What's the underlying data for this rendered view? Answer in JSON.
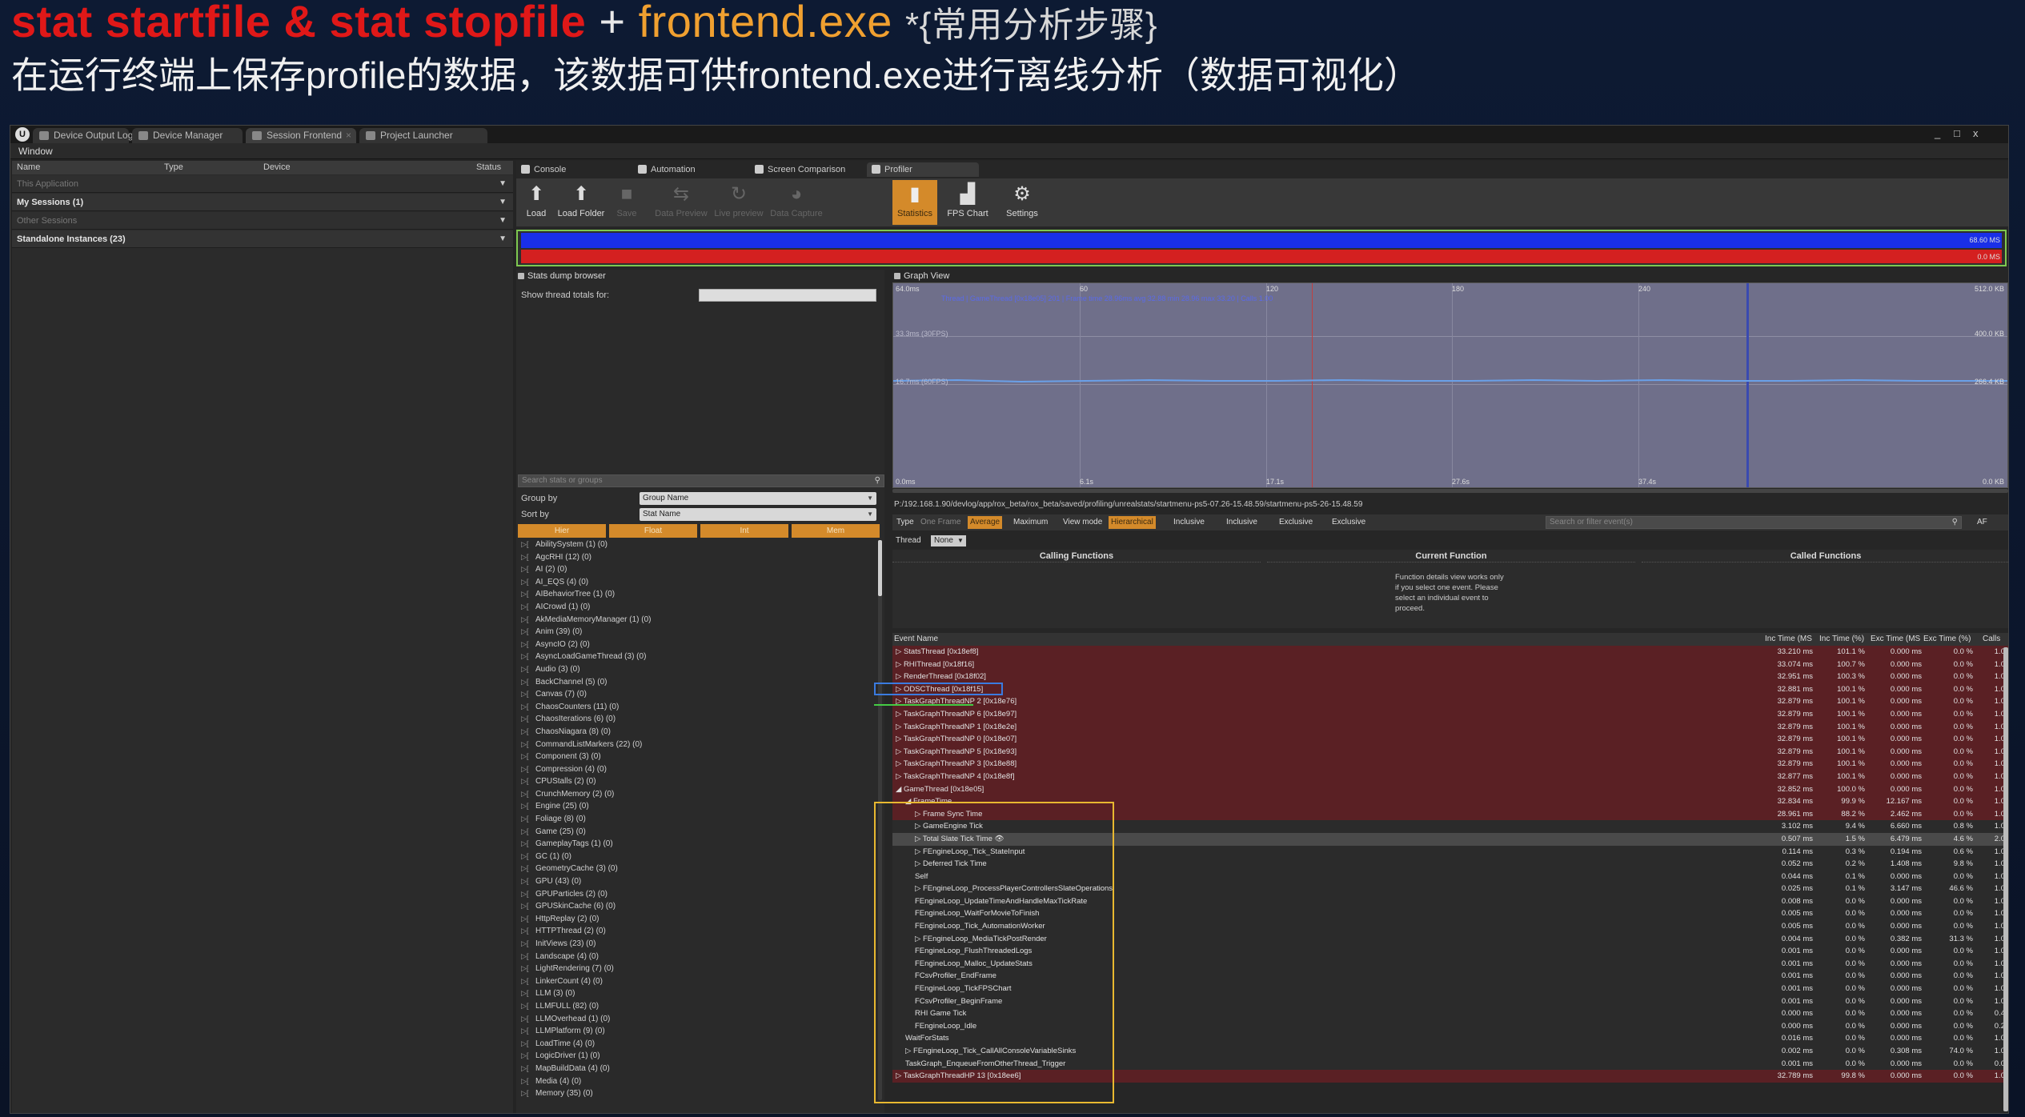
{
  "slide": {
    "title_red": "stat startfile & stat stopfile",
    "title_plus": "+",
    "title_exe": "frontend.exe",
    "title_note": "*{常用分析步骤}",
    "subtitle": "在运行终端上保存profile的数据，该数据可供frontend.exe进行离线分析（数据可视化）"
  },
  "window": {
    "tabs": [
      "Device Output Log",
      "Device Manager",
      "Session Frontend",
      "Project Launcher"
    ],
    "menu": "Window",
    "controls": [
      "_",
      "□",
      "x"
    ]
  },
  "sessions": {
    "columns": [
      "Name",
      "Type",
      "Device",
      "Status"
    ],
    "rows": [
      {
        "label": "This Application",
        "style": "dim"
      },
      {
        "label": "My Sessions (1)",
        "style": "bold"
      },
      {
        "label": "Other Sessions",
        "style": "dim"
      },
      {
        "label": "Standalone Instances (23)",
        "style": "bold"
      }
    ]
  },
  "profiler": {
    "tabs": [
      "Console",
      "Automation",
      "Screen Comparison",
      "Profiler"
    ],
    "toolbar": [
      {
        "label": "Load",
        "state": "normal",
        "icon": "load-icon"
      },
      {
        "label": "Load Folder",
        "state": "normal",
        "icon": "load-folder-icon"
      },
      {
        "label": "Save",
        "state": "disabled",
        "icon": "save-icon"
      },
      {
        "label": "Data Preview",
        "state": "disabled",
        "icon": "data-preview-icon"
      },
      {
        "label": "Live preview",
        "state": "disabled",
        "icon": "live-preview-icon"
      },
      {
        "label": "Data Capture",
        "state": "disabled",
        "icon": "data-capture-icon"
      },
      {
        "label": "Statistics",
        "state": "active",
        "icon": "statistics-icon"
      },
      {
        "label": "FPS Chart",
        "state": "normal",
        "icon": "fps-chart-icon"
      },
      {
        "label": "Settings",
        "state": "normal",
        "icon": "settings-icon"
      }
    ],
    "overview": {
      "top_value": "68.60 MS",
      "bottom_value": "0.0 MS"
    }
  },
  "stats_browser": {
    "title": "Stats dump browser",
    "show_thread_label": "Show thread totals for:",
    "search_placeholder": "Search stats or groups",
    "group_by_label": "Group by",
    "group_by_value": "Group Name",
    "sort_by_label": "Sort by",
    "sort_by_value": "Stat Name",
    "filters": [
      "Hier",
      "Float",
      "Int",
      "Mem"
    ],
    "groups": [
      "AbilitySystem (1) (0)",
      "AgcRHI (12) (0)",
      "AI (2) (0)",
      "AI_EQS (4) (0)",
      "AIBehaviorTree (1) (0)",
      "AICrowd (1) (0)",
      "AkMediaMemoryManager (1) (0)",
      "Anim (39) (0)",
      "AsyncIO (2) (0)",
      "AsyncLoadGameThread (3) (0)",
      "Audio (3) (0)",
      "BackChannel (5) (0)",
      "Canvas (7) (0)",
      "ChaosCounters (11) (0)",
      "ChaosIterations (6) (0)",
      "ChaosNiagara (8) (0)",
      "CommandListMarkers (22) (0)",
      "Component (3) (0)",
      "Compression (4) (0)",
      "CPUStalls (2) (0)",
      "CrunchMemory (2) (0)",
      "Engine (25) (0)",
      "Foliage (8) (0)",
      "Game (25) (0)",
      "GameplayTags (1) (0)",
      "GC (1) (0)",
      "GeometryCache (3) (0)",
      "GPU (43) (0)",
      "GPUParticles (2) (0)",
      "GPUSkinCache (6) (0)",
      "HttpReplay (2) (0)",
      "HTTPThread (2) (0)",
      "InitViews (23) (0)",
      "Landscape (4) (0)",
      "LightRendering (7) (0)",
      "LinkerCount (4) (0)",
      "LLM (3) (0)",
      "LLMFULL (82) (0)",
      "LLMOverhead (1) (0)",
      "LLMPlatform (9) (0)",
      "LoadTime (4) (0)",
      "LogicDriver (1) (0)",
      "MapBuildData (4) (0)",
      "Media (4) (0)",
      "Memory (35) (0)"
    ]
  },
  "graph_view": {
    "title": "Graph View",
    "x_ticks_top": [
      "64.0ms",
      "60",
      "120",
      "180",
      "240"
    ],
    "x_ticks_bottom": [
      "0.0ms",
      "6.1s",
      "17.1s",
      "27.6s",
      "37.4s"
    ],
    "y_right": [
      "512.0 KB",
      "400.0 KB",
      "266.4 KB",
      "0.0 KB"
    ],
    "mid_labels": [
      "33.3ms (30FPS)",
      "16.7ms (60FPS)"
    ],
    "legend_text": "Thread | GameThread [0x18e05] 201 | Frame time 28.96ms avg 32.88 min 28.96 max 33.20 | Calls 1.00"
  },
  "events": {
    "path": "P:/192.168.1.90/devlog/app/rox_beta/rox_beta/saved/profiling/unrealstats/startmenu-ps5-07.26-15.48.59/startmenu-ps5-26-15.48.59",
    "toolbar": {
      "type_label": "Type",
      "type_buttons": [
        "One Frame",
        "Average",
        "Maximum"
      ],
      "view_mode_label": "View mode",
      "view_buttons": [
        "Hierarchical",
        "Inclusive",
        "Inclusive",
        "Exclusive",
        "Exclusive"
      ],
      "search_placeholder": "Search or filter event(s)",
      "af": "AF"
    },
    "thread_label": "Thread",
    "thread_value": "None",
    "function_details": {
      "calling": "Calling Functions",
      "current": "Current Function",
      "called": "Called Functions",
      "message": "Function details view works only if you select one event. Please select an individual event to proceed."
    },
    "columns": [
      "Event Name",
      "Inc Time (MS",
      "Inc Time (%)",
      "Exc Time (MS",
      "Exc Time (%)",
      "Calls"
    ],
    "rows": [
      {
        "indent": 0,
        "arrow": "▷",
        "name": "StatsThread [0x18ef8]",
        "inc_ms": "33.210 ms",
        "inc_pct": "101.1 %",
        "exc_ms": "0.000 ms",
        "exc_pct": "0.0 %",
        "calls": "1.0",
        "style": "red"
      },
      {
        "indent": 0,
        "arrow": "▷",
        "name": "RHIThread [0x18f16]",
        "inc_ms": "33.074 ms",
        "inc_pct": "100.7 %",
        "exc_ms": "0.000 ms",
        "exc_pct": "0.0 %",
        "calls": "1.0",
        "style": "red"
      },
      {
        "indent": 0,
        "arrow": "▷",
        "name": "RenderThread [0x18f02]",
        "inc_ms": "32.951 ms",
        "inc_pct": "100.3 %",
        "exc_ms": "0.000 ms",
        "exc_pct": "0.0 %",
        "calls": "1.0",
        "style": "red"
      },
      {
        "indent": 0,
        "arrow": "▷",
        "name": "ODSCThread [0x18f15]",
        "inc_ms": "32.881 ms",
        "inc_pct": "100.1 %",
        "exc_ms": "0.000 ms",
        "exc_pct": "0.0 %",
        "calls": "1.0",
        "style": "red"
      },
      {
        "indent": 0,
        "arrow": "▷",
        "name": "TaskGraphThreadNP 2 [0x18e76]",
        "inc_ms": "32.879 ms",
        "inc_pct": "100.1 %",
        "exc_ms": "0.000 ms",
        "exc_pct": "0.0 %",
        "calls": "1.0",
        "style": "red"
      },
      {
        "indent": 0,
        "arrow": "▷",
        "name": "TaskGraphThreadNP 6 [0x18e97]",
        "inc_ms": "32.879 ms",
        "inc_pct": "100.1 %",
        "exc_ms": "0.000 ms",
        "exc_pct": "0.0 %",
        "calls": "1.0",
        "style": "red"
      },
      {
        "indent": 0,
        "arrow": "▷",
        "name": "TaskGraphThreadNP 1 [0x18e2e]",
        "inc_ms": "32.879 ms",
        "inc_pct": "100.1 %",
        "exc_ms": "0.000 ms",
        "exc_pct": "0.0 %",
        "calls": "1.0",
        "style": "red"
      },
      {
        "indent": 0,
        "arrow": "▷",
        "name": "TaskGraphThreadNP 0 [0x18e07]",
        "inc_ms": "32.879 ms",
        "inc_pct": "100.1 %",
        "exc_ms": "0.000 ms",
        "exc_pct": "0.0 %",
        "calls": "1.0",
        "style": "red"
      },
      {
        "indent": 0,
        "arrow": "▷",
        "name": "TaskGraphThreadNP 5 [0x18e93]",
        "inc_ms": "32.879 ms",
        "inc_pct": "100.1 %",
        "exc_ms": "0.000 ms",
        "exc_pct": "0.0 %",
        "calls": "1.0",
        "style": "red"
      },
      {
        "indent": 0,
        "arrow": "▷",
        "name": "TaskGraphThreadNP 3 [0x18e88]",
        "inc_ms": "32.879 ms",
        "inc_pct": "100.1 %",
        "exc_ms": "0.000 ms",
        "exc_pct": "0.0 %",
        "calls": "1.0",
        "style": "red"
      },
      {
        "indent": 0,
        "arrow": "▷",
        "name": "TaskGraphThreadNP 4 [0x18e8f]",
        "inc_ms": "32.877 ms",
        "inc_pct": "100.1 %",
        "exc_ms": "0.000 ms",
        "exc_pct": "0.0 %",
        "calls": "1.0",
        "style": "red"
      },
      {
        "indent": 0,
        "arrow": "◢",
        "name": "GameThread [0x18e05]",
        "inc_ms": "32.852 ms",
        "inc_pct": "100.0 %",
        "exc_ms": "0.000 ms",
        "exc_pct": "0.0 %",
        "calls": "1.0",
        "style": "red"
      },
      {
        "indent": 1,
        "arrow": "◢",
        "name": "FrameTime",
        "inc_ms": "32.834 ms",
        "inc_pct": "99.9 %",
        "exc_ms": "12.167 ms",
        "exc_pct": "0.0 %",
        "calls": "1.0",
        "style": "red"
      },
      {
        "indent": 2,
        "arrow": "▷",
        "name": "Frame Sync Time",
        "inc_ms": "28.961 ms",
        "inc_pct": "88.2 %",
        "exc_ms": "2.462 ms",
        "exc_pct": "0.0 %",
        "calls": "1.0",
        "style": "red"
      },
      {
        "indent": 2,
        "arrow": "▷",
        "name": "GameEngine Tick",
        "inc_ms": "3.102 ms",
        "inc_pct": "9.4 %",
        "exc_ms": "6.660 ms",
        "exc_pct": "0.8 %",
        "calls": "1.0",
        "style": "dark"
      },
      {
        "indent": 2,
        "arrow": "▷",
        "name": "Total Slate Tick Time 👁",
        "inc_ms": "0.507 ms",
        "inc_pct": "1.5 %",
        "exc_ms": "6.479 ms",
        "exc_pct": "4.6 %",
        "calls": "2.0",
        "style": "hi"
      },
      {
        "indent": 2,
        "arrow": "▷",
        "name": "FEngineLoop_Tick_StateInput",
        "inc_ms": "0.114 ms",
        "inc_pct": "0.3 %",
        "exc_ms": "0.194 ms",
        "exc_pct": "0.6 %",
        "calls": "1.0",
        "style": "dark"
      },
      {
        "indent": 2,
        "arrow": "▷",
        "name": "Deferred Tick Time",
        "inc_ms": "0.052 ms",
        "inc_pct": "0.2 %",
        "exc_ms": "1.408 ms",
        "exc_pct": "9.8 %",
        "calls": "1.0",
        "style": "dark"
      },
      {
        "indent": 2,
        "arrow": "",
        "name": "Self",
        "inc_ms": "0.044 ms",
        "inc_pct": "0.1 %",
        "exc_ms": "0.000 ms",
        "exc_pct": "0.0 %",
        "calls": "1.0",
        "style": "dark"
      },
      {
        "indent": 2,
        "arrow": "▷",
        "name": "FEngineLoop_ProcessPlayerControllersSlateOperations",
        "inc_ms": "0.025 ms",
        "inc_pct": "0.1 %",
        "exc_ms": "3.147 ms",
        "exc_pct": "46.6 %",
        "calls": "1.0",
        "style": "dark"
      },
      {
        "indent": 2,
        "arrow": "",
        "name": "FEngineLoop_UpdateTimeAndHandleMaxTickRate",
        "inc_ms": "0.008 ms",
        "inc_pct": "0.0 %",
        "exc_ms": "0.000 ms",
        "exc_pct": "0.0 %",
        "calls": "1.0",
        "style": "dark"
      },
      {
        "indent": 2,
        "arrow": "",
        "name": "FEngineLoop_WaitForMovieToFinish",
        "inc_ms": "0.005 ms",
        "inc_pct": "0.0 %",
        "exc_ms": "0.000 ms",
        "exc_pct": "0.0 %",
        "calls": "1.0",
        "style": "dark"
      },
      {
        "indent": 2,
        "arrow": "",
        "name": "FEngineLoop_Tick_AutomationWorker",
        "inc_ms": "0.005 ms",
        "inc_pct": "0.0 %",
        "exc_ms": "0.000 ms",
        "exc_pct": "0.0 %",
        "calls": "1.0",
        "style": "dark"
      },
      {
        "indent": 2,
        "arrow": "▷",
        "name": "FEngineLoop_MediaTickPostRender",
        "inc_ms": "0.004 ms",
        "inc_pct": "0.0 %",
        "exc_ms": "0.382 ms",
        "exc_pct": "31.3 %",
        "calls": "1.0",
        "style": "dark"
      },
      {
        "indent": 2,
        "arrow": "",
        "name": "FEngineLoop_FlushThreadedLogs",
        "inc_ms": "0.001 ms",
        "inc_pct": "0.0 %",
        "exc_ms": "0.000 ms",
        "exc_pct": "0.0 %",
        "calls": "1.0",
        "style": "dark"
      },
      {
        "indent": 2,
        "arrow": "",
        "name": "FEngineLoop_Malloc_UpdateStats",
        "inc_ms": "0.001 ms",
        "inc_pct": "0.0 %",
        "exc_ms": "0.000 ms",
        "exc_pct": "0.0 %",
        "calls": "1.0",
        "style": "dark"
      },
      {
        "indent": 2,
        "arrow": "",
        "name": "FCsvProfiler_EndFrame",
        "inc_ms": "0.001 ms",
        "inc_pct": "0.0 %",
        "exc_ms": "0.000 ms",
        "exc_pct": "0.0 %",
        "calls": "1.0",
        "style": "dark"
      },
      {
        "indent": 2,
        "arrow": "",
        "name": "FEngineLoop_TickFPSChart",
        "inc_ms": "0.001 ms",
        "inc_pct": "0.0 %",
        "exc_ms": "0.000 ms",
        "exc_pct": "0.0 %",
        "calls": "1.0",
        "style": "dark"
      },
      {
        "indent": 2,
        "arrow": "",
        "name": "FCsvProfiler_BeginFrame",
        "inc_ms": "0.001 ms",
        "inc_pct": "0.0 %",
        "exc_ms": "0.000 ms",
        "exc_pct": "0.0 %",
        "calls": "1.0",
        "style": "dark"
      },
      {
        "indent": 2,
        "arrow": "",
        "name": "RHI Game Tick",
        "inc_ms": "0.000 ms",
        "inc_pct": "0.0 %",
        "exc_ms": "0.000 ms",
        "exc_pct": "0.0 %",
        "calls": "0.4",
        "style": "dark"
      },
      {
        "indent": 2,
        "arrow": "",
        "name": "FEngineLoop_Idle",
        "inc_ms": "0.000 ms",
        "inc_pct": "0.0 %",
        "exc_ms": "0.000 ms",
        "exc_pct": "0.0 %",
        "calls": "0.2",
        "style": "dark"
      },
      {
        "indent": 1,
        "arrow": "",
        "name": "WaitForStats",
        "inc_ms": "0.016 ms",
        "inc_pct": "0.0 %",
        "exc_ms": "0.000 ms",
        "exc_pct": "0.0 %",
        "calls": "1.0",
        "style": "dark"
      },
      {
        "indent": 1,
        "arrow": "▷",
        "name": "FEngineLoop_Tick_CallAllConsoleVariableSinks",
        "inc_ms": "0.002 ms",
        "inc_pct": "0.0 %",
        "exc_ms": "0.308 ms",
        "exc_pct": "74.0 %",
        "calls": "1.0",
        "style": "dark"
      },
      {
        "indent": 1,
        "arrow": "",
        "name": "TaskGraph_EnqueueFromOtherThread_Trigger",
        "inc_ms": "0.001 ms",
        "inc_pct": "0.0 %",
        "exc_ms": "0.000 ms",
        "exc_pct": "0.0 %",
        "calls": "0.0",
        "style": "dark"
      },
      {
        "indent": 0,
        "arrow": "▷",
        "name": "TaskGraphThreadHP 13 [0x18ee6]",
        "inc_ms": "32.789 ms",
        "inc_pct": "99.8 %",
        "exc_ms": "0.000 ms",
        "exc_pct": "0.0 %",
        "calls": "1.0",
        "style": "red"
      }
    ]
  },
  "colors": {
    "accent_orange": "#d48a2a",
    "overview_blue": "#1a2fe8",
    "overview_red": "#d42020",
    "highlight_blue": "#3a7be0",
    "highlight_green": "#44cc44",
    "highlight_yellow": "#e8b830"
  }
}
